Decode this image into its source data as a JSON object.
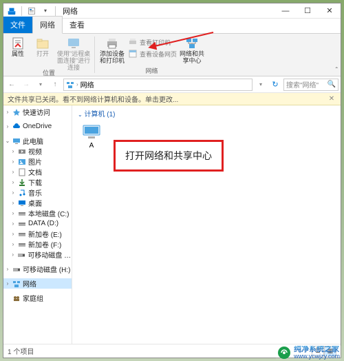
{
  "window": {
    "title": "网络"
  },
  "titlebar": {
    "min": "—",
    "max": "☐",
    "close": "✕"
  },
  "ribbon": {
    "tabs": {
      "file": "文件",
      "network": "网络",
      "view": "查看"
    },
    "groups": {
      "location": {
        "label": "位置",
        "properties": "属性",
        "open": "打开",
        "remote_desktop": "使用\"远程桌面连接\"进行连接"
      },
      "network": {
        "label": "网络",
        "add_device": "添加设备和打印机",
        "view_printers": "查看打印机",
        "view_device_page": "查看设备网页",
        "network_center": "网络和共享中心"
      }
    }
  },
  "addressbar": {
    "segments": [
      "网络"
    ],
    "search_placeholder": "搜索\"网络\"",
    "refresh": "↻"
  },
  "infobar": {
    "text": "文件共享已关闭。看不到网络计算机和设备。单击更改..."
  },
  "nav": {
    "quick_access": "快速访问",
    "onedrive": "OneDrive",
    "this_pc": "此电脑",
    "videos": "视频",
    "pictures": "图片",
    "documents": "文档",
    "downloads": "下载",
    "music": "音乐",
    "desktop": "桌面",
    "disk_c": "本地磁盘 (C:)",
    "disk_d": "DATA (D:)",
    "disk_e": "新加卷 (E:)",
    "disk_f": "新加卷 (F:)",
    "disk_h": "可移动磁盘 (H:)",
    "disk_h2": "可移动磁盘 (H:)",
    "network": "网络",
    "homegroup": "家庭组"
  },
  "content": {
    "group_header": "计算机 (1)",
    "items": [
      {
        "label": "A"
      }
    ],
    "callout": "打开网络和共享中心"
  },
  "statusbar": {
    "item_count": "1 个项目"
  },
  "watermark": {
    "line1": "纯净系统之家",
    "line2": "www.ycwjzy.com"
  }
}
